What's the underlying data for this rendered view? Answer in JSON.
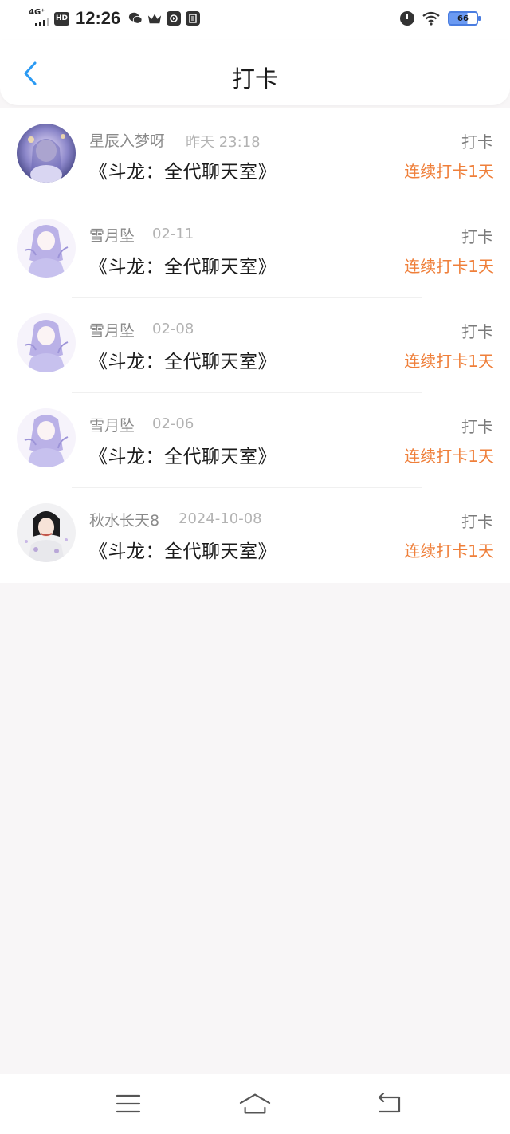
{
  "status_bar": {
    "network": "4G⁺",
    "hd": "HD",
    "time": "12:26",
    "battery": "66",
    "colors": {
      "battery": "#6b9af2"
    }
  },
  "header": {
    "title": "打卡",
    "back_icon": "chevron-left-icon",
    "colors": {
      "back": "#2b9af3"
    }
  },
  "list": [
    {
      "username": "星辰入梦呀",
      "time": "昨天 23:18",
      "room": "《斗龙：全代聊天室》",
      "action": "打卡",
      "streak": "连续打卡1天",
      "avatar": "avatar-fantasy-girl"
    },
    {
      "username": "雪月坠",
      "time": "02-11",
      "room": "《斗龙：全代聊天室》",
      "action": "打卡",
      "streak": "连续打卡1天",
      "avatar": "avatar-anime-girl"
    },
    {
      "username": "雪月坠",
      "time": "02-08",
      "room": "《斗龙：全代聊天室》",
      "action": "打卡",
      "streak": "连续打卡1天",
      "avatar": "avatar-anime-girl"
    },
    {
      "username": "雪月坠",
      "time": "02-06",
      "room": "《斗龙：全代聊天室》",
      "action": "打卡",
      "streak": "连续打卡1天",
      "avatar": "avatar-anime-girl"
    },
    {
      "username": "秋水长天8",
      "time": "2024-10-08",
      "room": "《斗龙：全代聊天室》",
      "action": "打卡",
      "streak": "连续打卡1天",
      "avatar": "avatar-dark-hair-girl"
    }
  ],
  "colors": {
    "streak": "#ef7f3a",
    "username": "#8a8a8a",
    "time": "#b3b3b3"
  },
  "bottom_nav": {
    "icons": [
      "menu-icon",
      "home-icon",
      "back-icon"
    ]
  }
}
